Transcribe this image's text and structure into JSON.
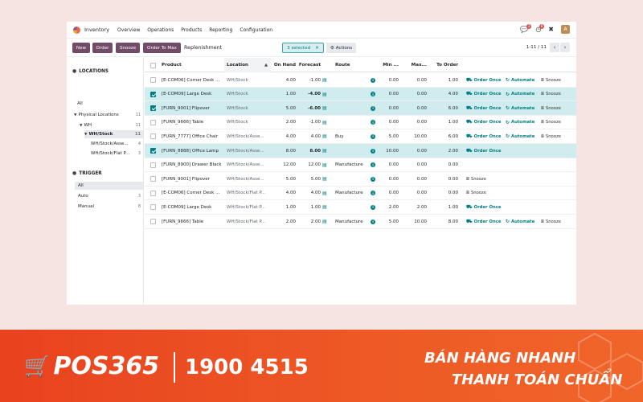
{
  "topnav": {
    "app_name": "Inventory",
    "menu": [
      "Overview",
      "Operations",
      "Products",
      "Reporting",
      "Configuration"
    ],
    "messages_badge": "3",
    "activities_badge": "8",
    "user_initial": "A"
  },
  "control_panel": {
    "new_label": "New",
    "order_label": "Order",
    "snooze_label": "Snooze",
    "order_to_max_label": "Order To Max",
    "breadcrumb": "Replenishment",
    "selected_label": "3 selected",
    "actions_label": "Actions",
    "pager": "1-11 / 11"
  },
  "sidebar": {
    "locations_title": "LOCATIONS",
    "locations": [
      {
        "label": "All",
        "count": ""
      },
      {
        "label": "Physical Locations",
        "count": "11"
      },
      {
        "label": "WH",
        "count": "11"
      },
      {
        "label": "WH/Stock",
        "count": "11"
      },
      {
        "label": "WH/Stock/Asse...",
        "count": "4"
      },
      {
        "label": "WH/Stock/Flat P...",
        "count": "3"
      }
    ],
    "trigger_title": "TRIGGER",
    "triggers": [
      {
        "label": "All",
        "count": ""
      },
      {
        "label": "Auto",
        "count": "3"
      },
      {
        "label": "Manual",
        "count": "8"
      }
    ]
  },
  "table": {
    "headers": {
      "product": "Product",
      "location": "Location",
      "on_hand": "On Hand",
      "forecast": "Forecast",
      "route": "Route",
      "min": "Min ...",
      "max": "Max...",
      "to_order": "To Order"
    },
    "action_labels": {
      "order_once": "Order Once",
      "automate": "Automate",
      "snooze": "Snooze"
    },
    "rows": [
      {
        "product": "[E-COM06] Corner Desk ...",
        "location": "WH/Stock",
        "on_hand": "4.00",
        "forecast": "-1.00",
        "route": "",
        "min": "0.00",
        "max": "0.00",
        "to_order": "1.00"
      },
      {
        "product": "[E-COM09] Large Desk",
        "location": "WH/Stock",
        "on_hand": "1.00",
        "forecast": "-4.00",
        "route": "",
        "min": "0.00",
        "max": "0.00",
        "to_order": "4.00"
      },
      {
        "product": "[FURN_9001] Flipover",
        "location": "WH/Stock",
        "on_hand": "5.00",
        "forecast": "-6.00",
        "route": "",
        "min": "0.00",
        "max": "0.00",
        "to_order": "6.00"
      },
      {
        "product": "[FURN_9666] Table",
        "location": "WH/Stock",
        "on_hand": "2.00",
        "forecast": "-1.00",
        "route": "",
        "min": "0.00",
        "max": "0.00",
        "to_order": "1.00"
      },
      {
        "product": "[FURN_7777] Office Chair",
        "location": "WH/Stock/Asse...",
        "on_hand": "4.00",
        "forecast": "4.00",
        "route": "Buy",
        "min": "5.00",
        "max": "10.00",
        "to_order": "6.00"
      },
      {
        "product": "[FURN_8888] Office Lamp",
        "location": "WH/Stock/Asse...",
        "on_hand": "8.00",
        "forecast": "8.00",
        "route": "",
        "min": "10.00",
        "max": "0.00",
        "to_order": "2.00"
      },
      {
        "product": "[FURN_8900] Drawer Black",
        "location": "WH/Stock/Asse...",
        "on_hand": "12.00",
        "forecast": "12.00",
        "route": "Manufacture",
        "min": "0.00",
        "max": "0.00",
        "to_order": "0.00"
      },
      {
        "product": "[FURN_9001] Flipover",
        "location": "WH/Stock/Asse...",
        "on_hand": "5.00",
        "forecast": "5.00",
        "route": "",
        "min": "0.00",
        "max": "0.00",
        "to_order": "0.00"
      },
      {
        "product": "[E-COM06] Corner Desk ...",
        "location": "WH/Stock/Flat P...",
        "on_hand": "4.00",
        "forecast": "4.00",
        "route": "Manufacture",
        "min": "0.00",
        "max": "0.00",
        "to_order": "0.00"
      },
      {
        "product": "[E-COM09] Large Desk",
        "location": "WH/Stock/Flat P...",
        "on_hand": "1.00",
        "forecast": "1.00",
        "route": "",
        "min": "2.00",
        "max": "2.00",
        "to_order": "1.00"
      },
      {
        "product": "[FURN_9666] Table",
        "location": "WH/Stock/Flat P...",
        "on_hand": "2.00",
        "forecast": "2.00",
        "route": "Manufacture",
        "min": "5.00",
        "max": "10.00",
        "to_order": "8.00"
      }
    ]
  },
  "banner": {
    "brand": "POS365",
    "hotline": "1900 4515",
    "slogan_line1": "BÁN HÀNG NHANH",
    "slogan_line2": "THANH TOÁN CHUẨN"
  },
  "colors": {
    "primary": "#714b67",
    "accent_teal": "#017e84",
    "selected_row": "#d1ecee",
    "page_bg": "#f6e4e3",
    "banner": "#ee5a25"
  }
}
